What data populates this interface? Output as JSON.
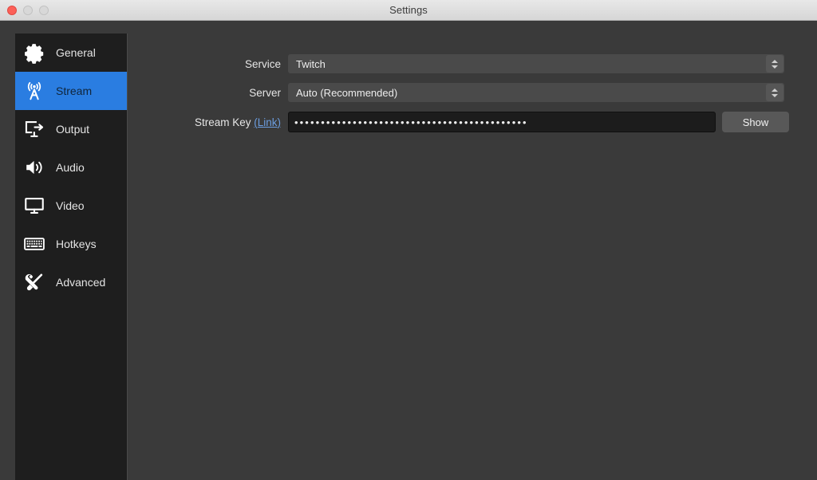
{
  "window": {
    "title": "Settings",
    "traffic_lights": [
      {
        "name": "close",
        "label": "Close"
      },
      {
        "name": "minimize",
        "label": "Minimize"
      },
      {
        "name": "zoom",
        "label": "Zoom"
      }
    ],
    "accent_color": "#2a7de1",
    "background_color": "#3a3a3a",
    "sidebar_color": "#1e1e1e"
  },
  "sidebar": {
    "items": [
      {
        "label": "General",
        "icon": "gear-icon",
        "selected": false
      },
      {
        "label": "Stream",
        "icon": "broadcast-icon",
        "selected": true
      },
      {
        "label": "Output",
        "icon": "output-icon",
        "selected": false
      },
      {
        "label": "Audio",
        "icon": "speaker-icon",
        "selected": false
      },
      {
        "label": "Video",
        "icon": "monitor-icon",
        "selected": false
      },
      {
        "label": "Hotkeys",
        "icon": "keyboard-icon",
        "selected": false
      },
      {
        "label": "Advanced",
        "icon": "tools-icon",
        "selected": false
      }
    ]
  },
  "form": {
    "service": {
      "label": "Service",
      "value": "Twitch",
      "options": [
        "Twitch"
      ]
    },
    "server": {
      "label": "Server",
      "value": "Auto (Recommended)",
      "options": [
        "Auto (Recommended)"
      ]
    },
    "stream_key": {
      "label": "Stream Key",
      "link_label": "(Link)",
      "value": "••••••••••••••••••••••••••••••••••••••••••••",
      "masked": true,
      "show_button_label": "Show"
    }
  }
}
